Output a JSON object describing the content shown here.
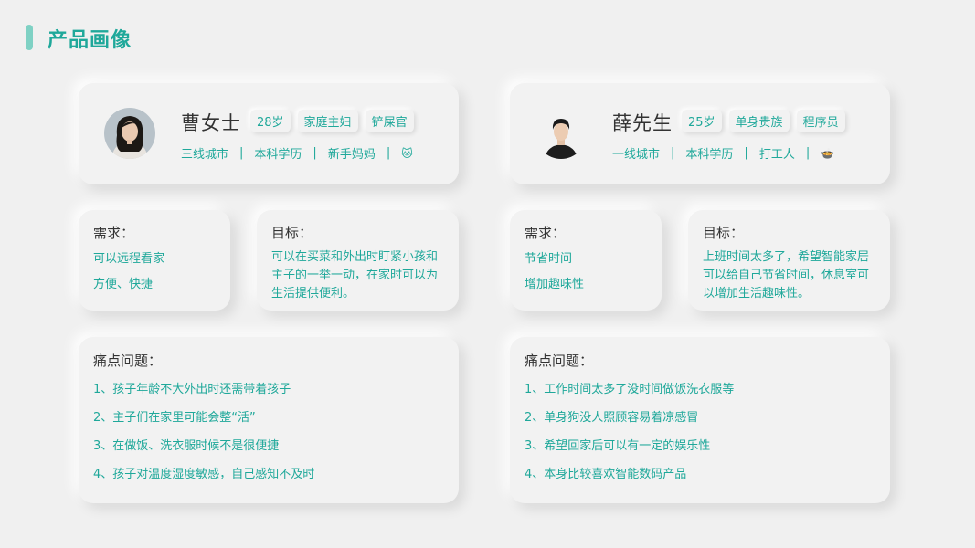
{
  "page_title": "产品画像",
  "personas": [
    {
      "name": "曹女士",
      "tags": [
        "28岁",
        "家庭主妇",
        "铲屎官"
      ],
      "attributes": [
        "三线城市",
        "本科学历",
        "新手妈妈"
      ],
      "attribute_icon": "cat-icon",
      "attribute_emoji": "🐱",
      "needs_title": "需求：",
      "needs": [
        "可以远程看家",
        "方便、快捷"
      ],
      "goal_title": "目标：",
      "goal": "可以在买菜和外出时盯紧小孩和主子的一举一动，在家时可以为生活提供便利。",
      "pain_title": "痛点问题：",
      "pains": [
        "1、孩子年龄不大外出时还需带着孩子",
        "2、主子们在家里可能会整“活”",
        "3、在做饭、洗衣服时候不是很便捷",
        "4、孩子对温度湿度敏感，自己感知不及时"
      ]
    },
    {
      "name": "薛先生",
      "tags": [
        "25岁",
        "单身贵族",
        "程序员"
      ],
      "attributes": [
        "一线城市",
        "本科学历",
        "打工人"
      ],
      "attribute_icon": "rice-cooker-icon",
      "attribute_emoji": "🍲",
      "needs_title": "需求：",
      "needs": [
        "节省时间",
        "增加趣味性"
      ],
      "goal_title": "目标：",
      "goal": "上班时间太多了，希望智能家居可以给自己节省时间，休息室可以增加生活趣味性。",
      "pain_title": "痛点问题：",
      "pains": [
        "1、工作时间太多了没时间做饭洗衣服等",
        "2、单身狗没人照顾容易着凉感冒",
        "3、希望回家后可以有一定的娱乐性",
        "4、本身比较喜欢智能数码产品"
      ]
    }
  ],
  "colors": {
    "accent": "#1fa89a",
    "accent_light": "#7fd1c4",
    "background": "#f0f0f0",
    "text": "#333333"
  }
}
